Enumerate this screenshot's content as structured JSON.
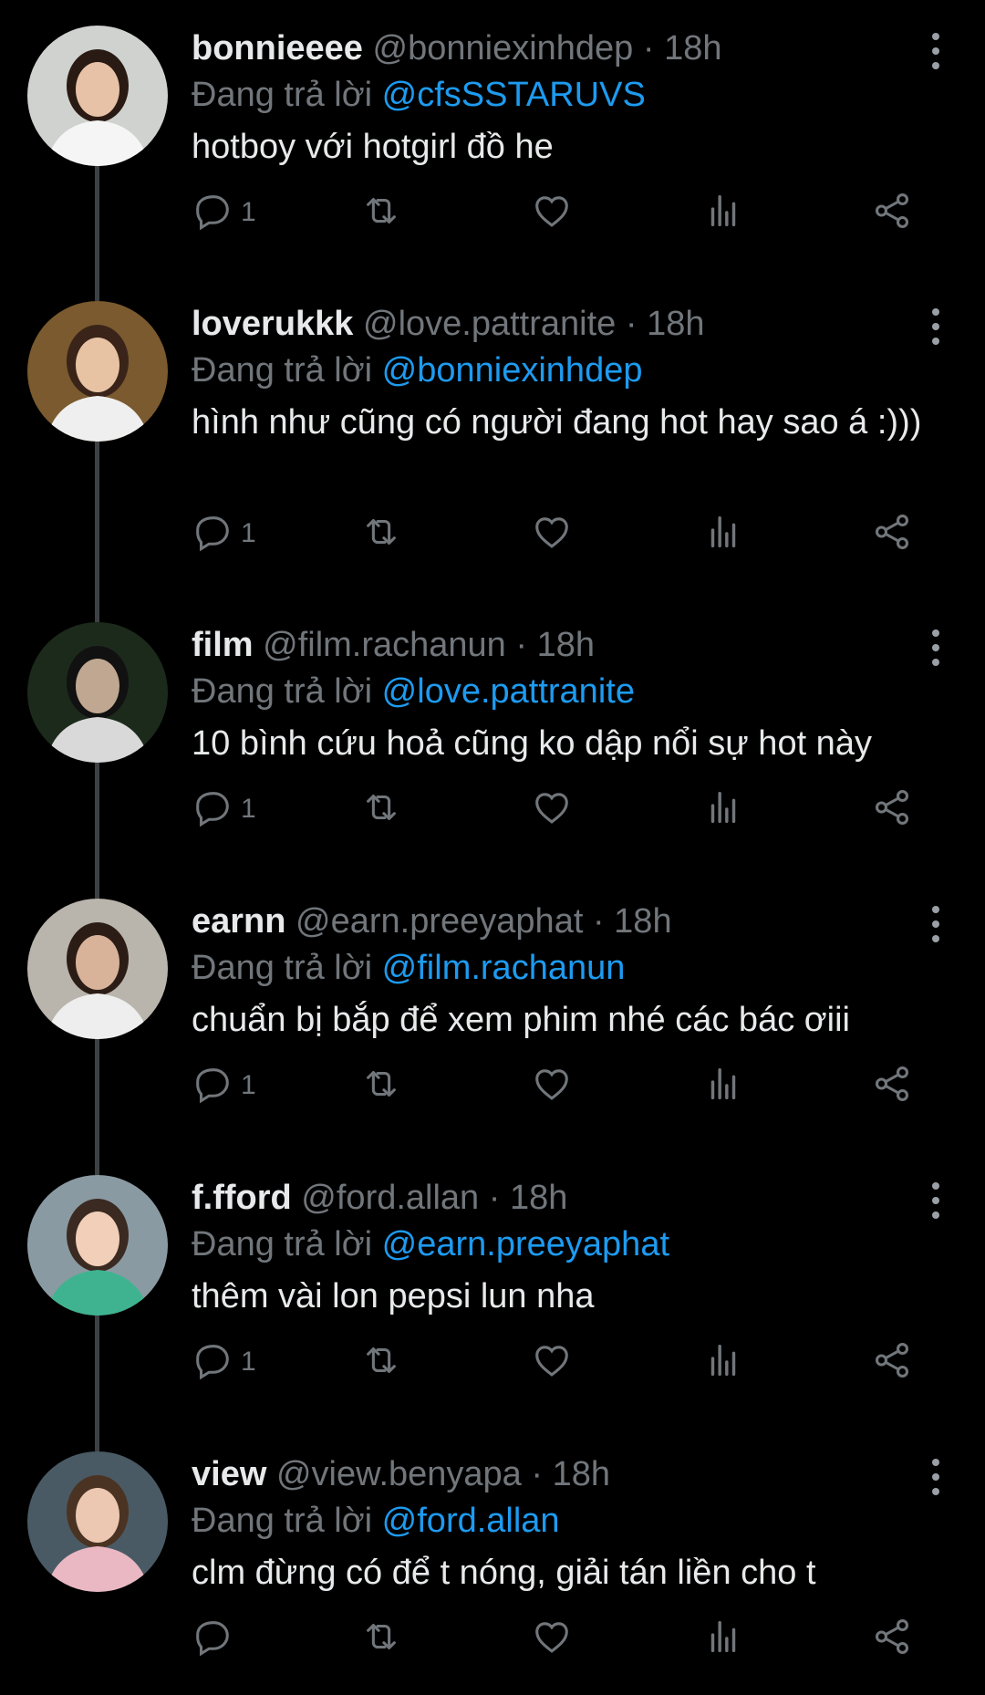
{
  "ui_colors": {
    "background": "#000000",
    "text": "#e7e9ea",
    "muted": "#71767b",
    "mention": "#1d9bf0",
    "thread_line": "#3e4144"
  },
  "icons": [
    "reply-icon",
    "repost-icon",
    "like-icon",
    "views-icon",
    "share-icon",
    "more-icon"
  ],
  "tweets": [
    {
      "display_name": "bonnieeee",
      "handle": "@bonniexinhdep",
      "time": "18h",
      "reply_prefix": "Đang trả lời",
      "reply_to": "@cfsSSTARUVS",
      "text": "hotboy với hotgirl đồ he",
      "reply_count": "1"
    },
    {
      "display_name": "loverukkk",
      "handle": "@love.pattranite",
      "time": "18h",
      "reply_prefix": "Đang trả lời",
      "reply_to": "@bonniexinhdep",
      "text": "hình như cũng có người đang hot hay sao á :)))",
      "reply_count": "1"
    },
    {
      "display_name": "film",
      "handle": "@film.rachanun",
      "time": "18h",
      "reply_prefix": "Đang trả lời",
      "reply_to": "@love.pattranite",
      "text": "10 bình cứu hoả cũng ko dập nổi sự hot này",
      "reply_count": "1"
    },
    {
      "display_name": "earnn",
      "handle": "@earn.preeyaphat",
      "time": "18h",
      "reply_prefix": "Đang trả lời",
      "reply_to": "@film.rachanun",
      "text": "chuẩn bị bắp để xem phim nhé các bác ơiii",
      "reply_count": "1"
    },
    {
      "display_name": "f.fford",
      "handle": "@ford.allan",
      "time": "18h",
      "reply_prefix": "Đang trả lời",
      "reply_to": "@earn.preeyaphat",
      "text": "thêm vài lon pepsi lun nha",
      "reply_count": "1"
    },
    {
      "display_name": "view",
      "handle": "@view.benyapa",
      "time": "18h",
      "reply_prefix": "Đang trả lời",
      "reply_to": "@ford.allan",
      "text": "clm đừng có để t nóng, giải tán liền cho t",
      "reply_count": ""
    }
  ]
}
